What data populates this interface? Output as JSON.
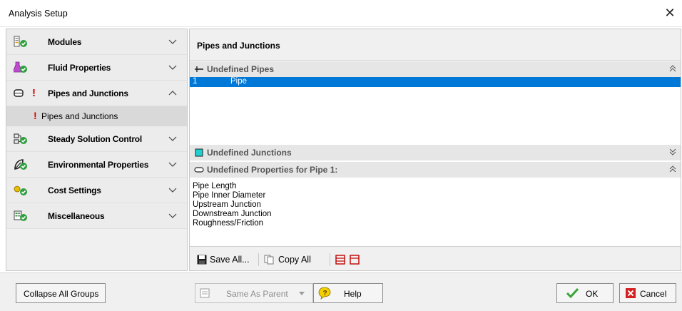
{
  "window": {
    "title": "Analysis Setup",
    "close_glyph": "✕"
  },
  "sidebar": {
    "items": [
      {
        "label": "Modules",
        "icon": "modules-icon",
        "expanded": false
      },
      {
        "label": "Fluid Properties",
        "icon": "flask-icon",
        "expanded": false
      },
      {
        "label": "Pipes and Junctions",
        "icon": "pipe-icon",
        "expanded": true,
        "status": "!"
      },
      {
        "label": "Steady Solution Control",
        "icon": "solution-control-icon",
        "expanded": false
      },
      {
        "label": "Environmental Properties",
        "icon": "leaf-icon",
        "expanded": false
      },
      {
        "label": "Cost Settings",
        "icon": "cost-icon",
        "expanded": false
      },
      {
        "label": "Miscellaneous",
        "icon": "misc-icon",
        "expanded": false
      }
    ],
    "subitem": {
      "label": "Pipes and Junctions",
      "status": "!"
    }
  },
  "main": {
    "header": "Pipes and Junctions",
    "undefined_pipes": {
      "label": "Undefined Pipes",
      "rows": [
        {
          "number": "1",
          "name": "Pipe"
        }
      ]
    },
    "undefined_junctions": {
      "label": "Undefined Junctions"
    },
    "undefined_properties": {
      "label": "Undefined Properties for Pipe 1:",
      "items": [
        "Pipe Length",
        "Pipe Inner Diameter",
        "Upstream Junction",
        "Downstream Junction",
        "Roughness/Friction"
      ]
    },
    "toolbar": {
      "save_all": "Save All...",
      "copy_all": "Copy All"
    }
  },
  "footer": {
    "collapse_all": "Collapse All Groups",
    "same_as_parent": "Same As Parent",
    "help": "Help",
    "ok": "OK",
    "cancel": "Cancel"
  },
  "colors": {
    "selection": "#0078d7",
    "check_green": "#2e9e3e",
    "error_red": "#d40000"
  }
}
